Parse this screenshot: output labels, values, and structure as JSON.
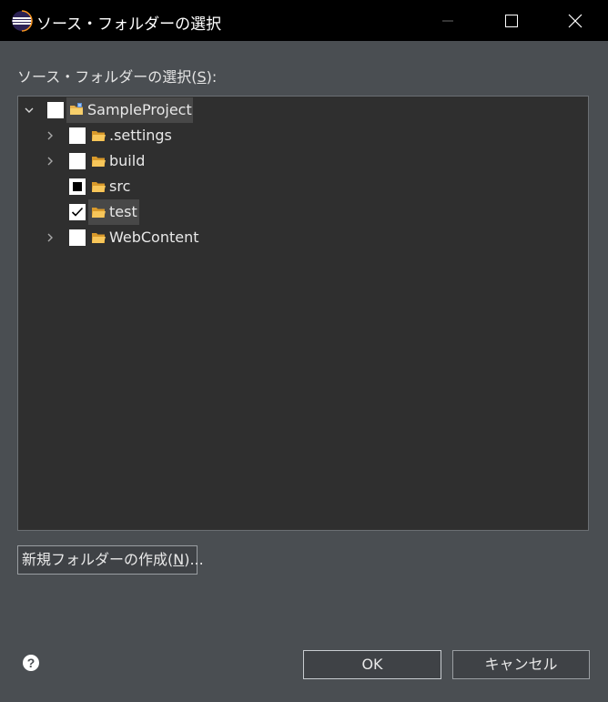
{
  "window": {
    "title": "ソース・フォルダーの選択",
    "minimize_icon": "minimize-icon",
    "maximize_icon": "maximize-icon",
    "close_icon": "close-icon"
  },
  "section_label": {
    "prefix": "ソース・フォルダーの選択(",
    "mnemonic": "S",
    "suffix": "):"
  },
  "tree": {
    "root": {
      "label": "SampleProject",
      "expanded": true,
      "checked": "unchecked",
      "icon": "project-folder-icon"
    },
    "children": [
      {
        "label": ".settings",
        "expandable": true,
        "checked": "unchecked",
        "icon": "folder-icon"
      },
      {
        "label": "build",
        "expandable": true,
        "checked": "unchecked",
        "icon": "folder-icon"
      },
      {
        "label": "src",
        "expandable": false,
        "checked": "partial",
        "icon": "folder-icon"
      },
      {
        "label": "test",
        "expandable": false,
        "checked": "checked",
        "icon": "folder-icon"
      },
      {
        "label": "WebContent",
        "expandable": true,
        "checked": "unchecked",
        "icon": "folder-icon"
      }
    ]
  },
  "buttons": {
    "new_folder": {
      "prefix": "新規フォルダーの作成(",
      "mnemonic": "N",
      "suffix": ")..."
    },
    "ok": "OK",
    "cancel": "キャンセル",
    "help_icon": "help-icon"
  },
  "colors": {
    "dialog_bg": "#4a4e52",
    "titlebar_bg": "#000000",
    "tree_bg": "#2f2f2f",
    "selection_bg": "#484848",
    "folder_color": "#f0b84a"
  }
}
